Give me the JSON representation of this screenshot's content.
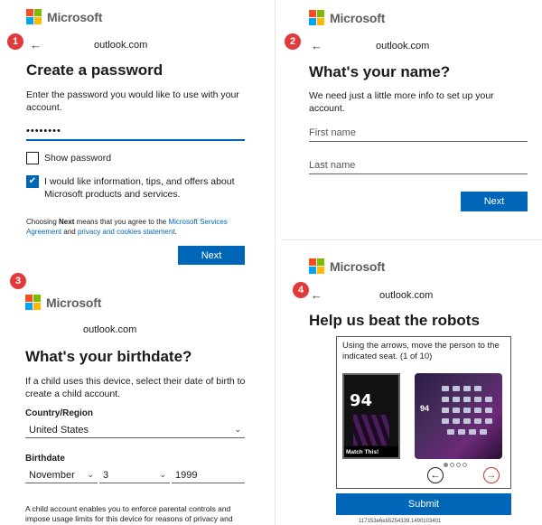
{
  "brand": {
    "name": "Microsoft",
    "colors": {
      "red": "#f25022",
      "green": "#7fba00",
      "blue": "#00a4ef",
      "yellow": "#ffb900"
    }
  },
  "accent_color": "#0067b8",
  "badge_color": "#e03a3a",
  "panel1": {
    "step": "1",
    "back_icon": "arrow-left-icon",
    "email": "outlook.com",
    "title": "Create a password",
    "description": "Enter the password you would like to use with your account.",
    "password_value": "••••••••",
    "show_password_label": "Show password",
    "show_password_checked": false,
    "marketing_label": "I would like information, tips, and offers about Microsoft products and services.",
    "marketing_checked": true,
    "legal_prefix": "Choosing ",
    "legal_bold": "Next",
    "legal_mid": " means that you agree to the ",
    "legal_link1": "Microsoft Services Agreement",
    "legal_and": " and ",
    "legal_link2": "privacy and cookies statement",
    "legal_end": ".",
    "next_label": "Next"
  },
  "panel2": {
    "step": "2",
    "back_icon": "arrow-left-icon",
    "email": "outlook.com",
    "title": "What's your name?",
    "description": "We need just a little more info to set up your account.",
    "first_name_placeholder": "First name",
    "last_name_placeholder": "Last name",
    "next_label": "Next"
  },
  "panel3": {
    "step": "3",
    "email": "outlook.com",
    "title": "What's your birthdate?",
    "description": "If a child uses this device, select their date of birth to create a child account.",
    "country_label": "Country/Region",
    "country_value": "United States",
    "birthdate_label": "Birthdate",
    "month_value": "November",
    "day_value": "3",
    "year_value": "1999",
    "child_notice": "A child account enables you to enforce parental controls and impose usage limits for this device for reasons of privacy and safety. You can manage these settings using our Family Safety"
  },
  "panel4": {
    "step": "4",
    "back_icon": "arrow-left-icon",
    "email": "outlook.com",
    "title": "Help us beat the robots",
    "captcha_instruction": "Using the arrows, move the person to the indicated seat. (1 of 10)",
    "captcha_number": "94",
    "captcha_match_label": "Match This!",
    "captcha_page": 1,
    "captcha_total_dots": 4,
    "submit_label": "Submit",
    "reference_code": "117153e6eb5254339.1490103401"
  }
}
